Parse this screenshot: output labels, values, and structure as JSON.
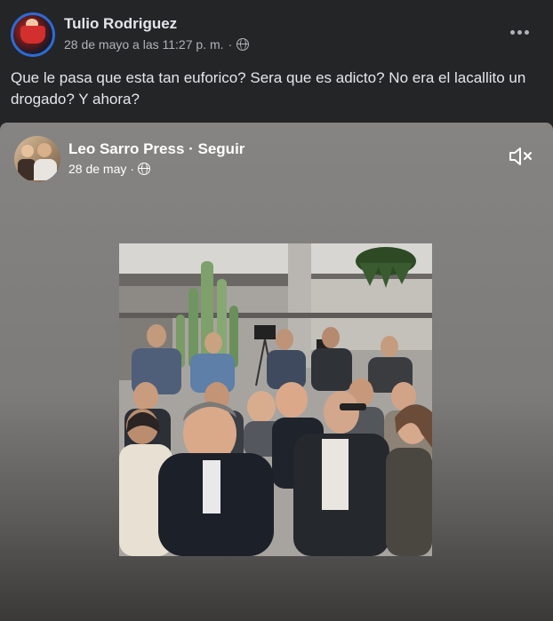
{
  "post": {
    "author": "Tulio Rodriguez",
    "date": "28 de mayo a las 11:27 p. m.",
    "separator": "·",
    "privacy_icon": "globe-icon",
    "more_icon": "more-horizontal-icon",
    "text": "Que le pasa que esta tan euforico? Sera que es adicto? No era el lacallito un drogado? Y ahora?"
  },
  "shared": {
    "author": "Leo Sarro Press · Seguir",
    "date": "28 de may",
    "separator": "·",
    "privacy_icon": "globe-icon",
    "mute_icon": "speaker-muted-icon"
  },
  "colors": {
    "background": "#242526",
    "text_primary": "#e4e6eb",
    "text_secondary": "#b0b3b8",
    "avatar_ring": "#2d6bd4"
  }
}
